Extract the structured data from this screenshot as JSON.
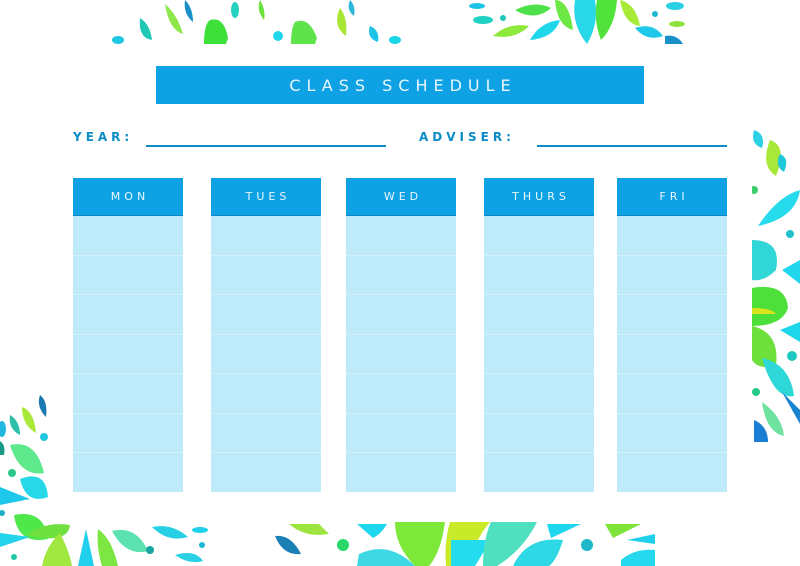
{
  "document": {
    "title": "CLASS SCHEDULE",
    "fields": [
      {
        "label": "YEAR:",
        "value": ""
      },
      {
        "label": "ADVISER:",
        "value": ""
      }
    ],
    "days": [
      {
        "label": "MON"
      },
      {
        "label": "TUES"
      },
      {
        "label": "WED"
      },
      {
        "label": "THURS"
      },
      {
        "label": "FRI"
      }
    ],
    "slots_per_day": 7
  },
  "colors": {
    "header_blue": "#0ea1e4",
    "label_blue": "#0b8cc4",
    "cell_light_blue": "#bfeaf9",
    "decor_green": "#4fe33a",
    "decor_cyan": "#1de0f2",
    "decor_lime": "#a6ef2a"
  }
}
